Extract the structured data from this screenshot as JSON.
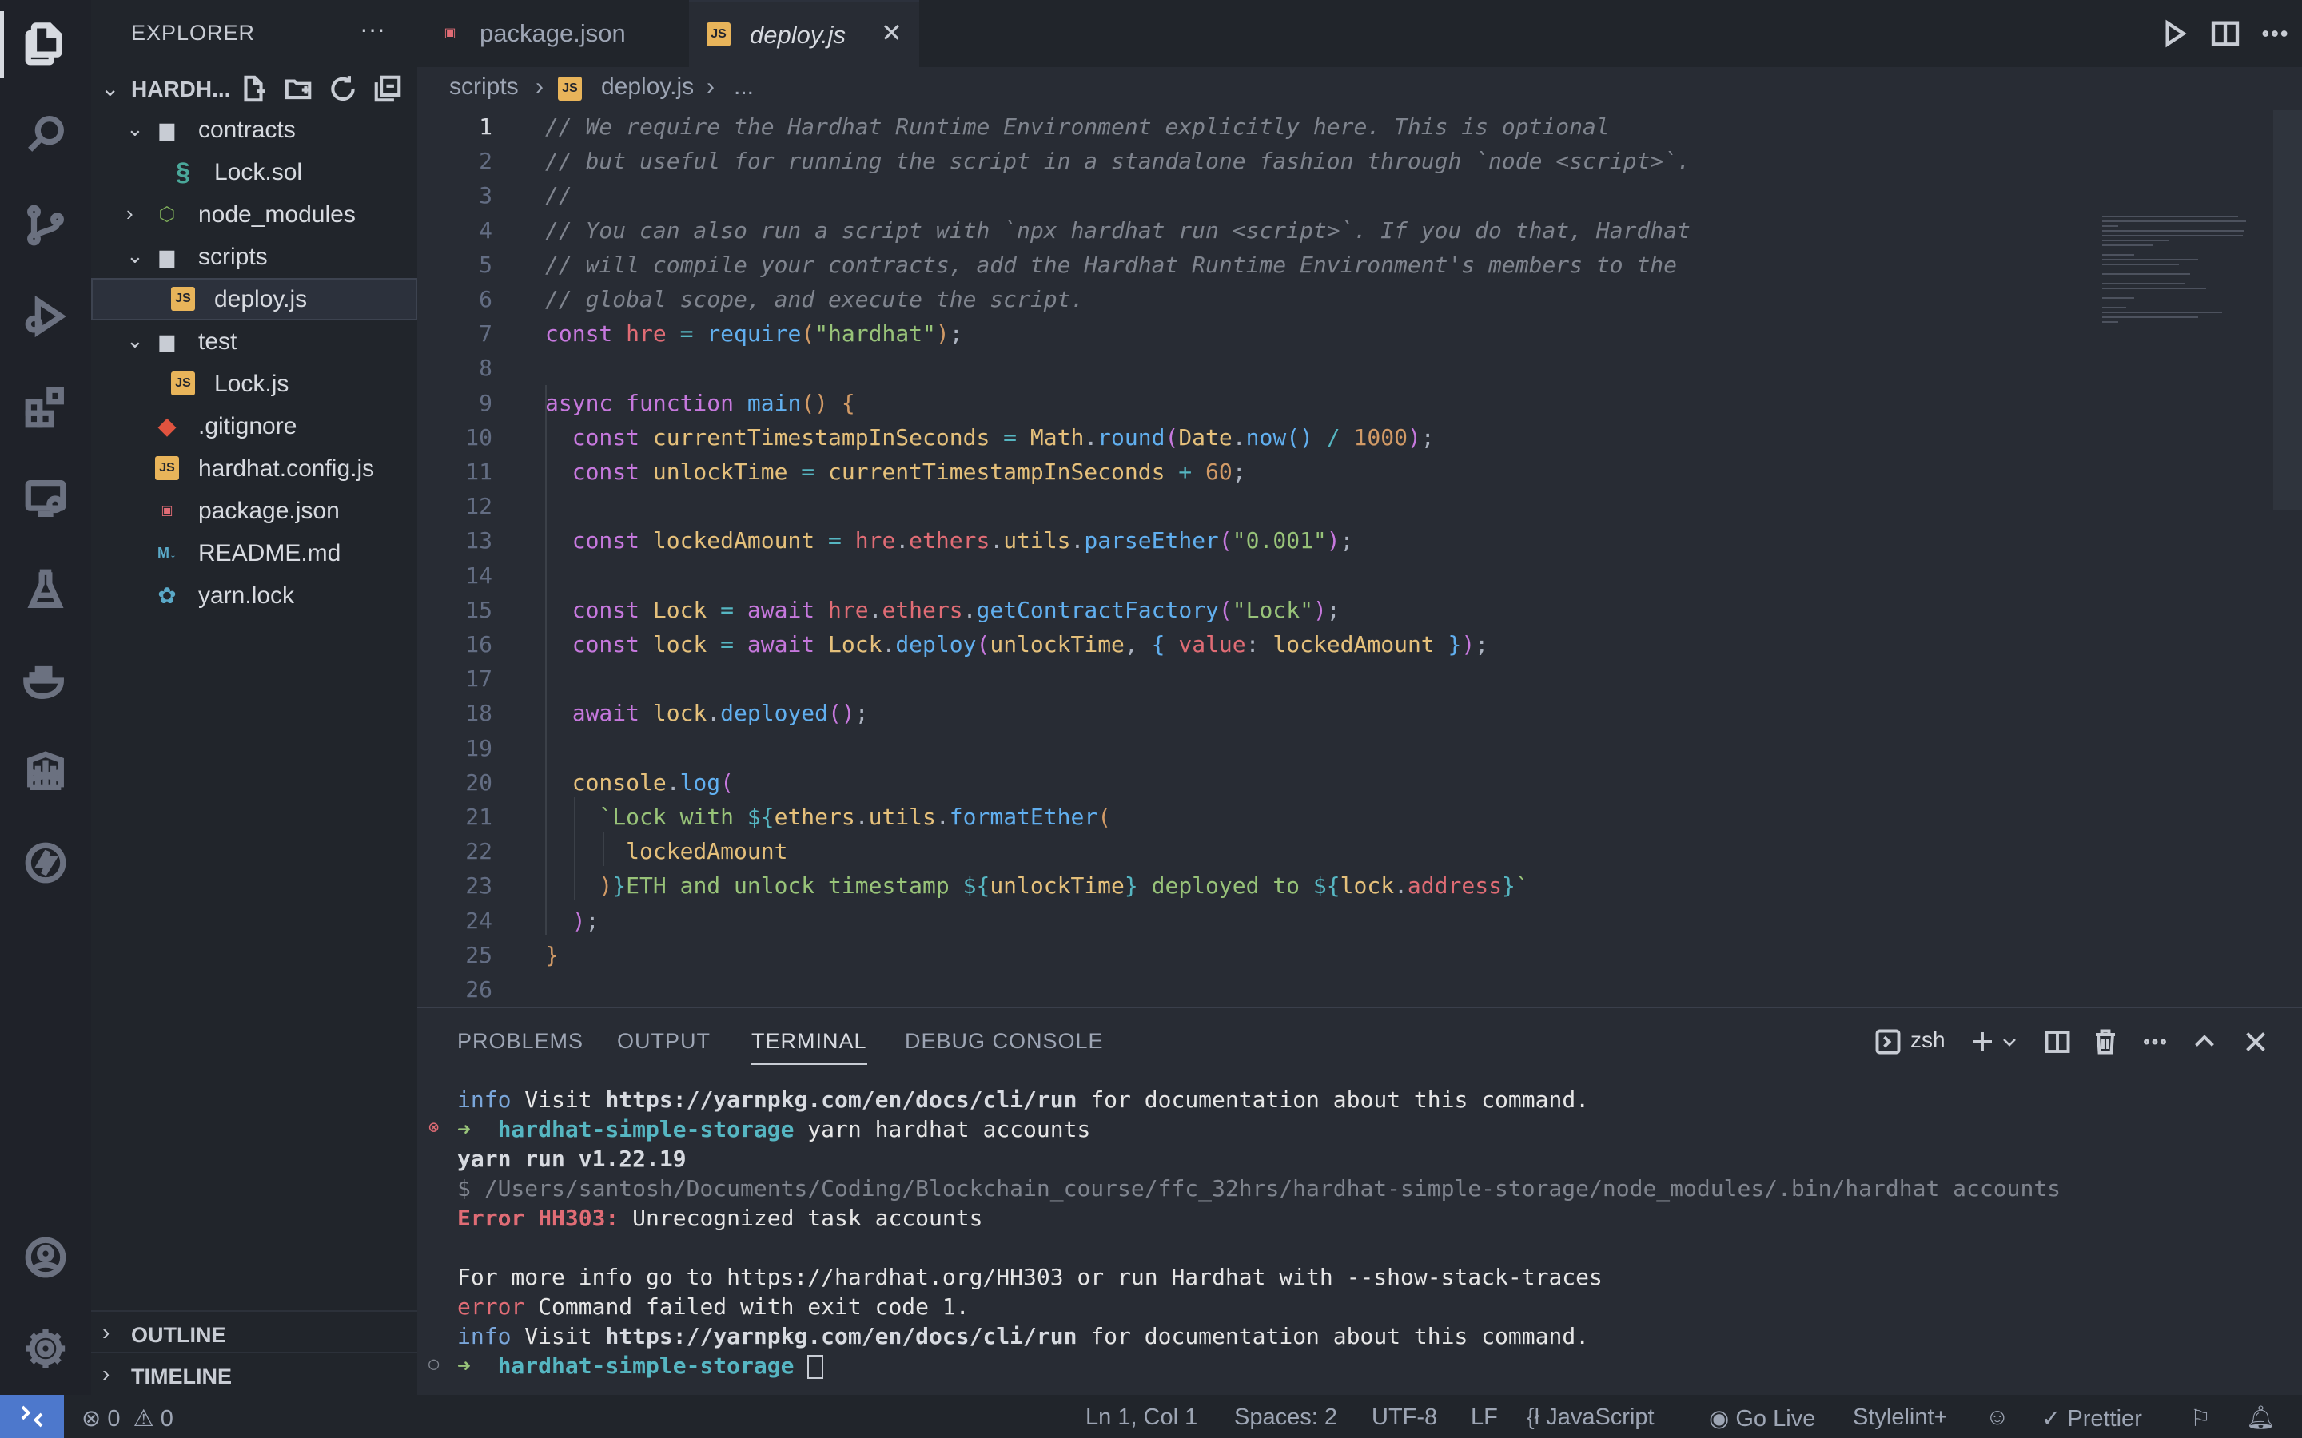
{
  "sidebar": {
    "title": "EXPLORER",
    "more": "···",
    "project": "HARDH...",
    "tree": [
      {
        "name": "contracts",
        "type": "folder",
        "open": true,
        "depth": 0
      },
      {
        "name": "Lock.sol",
        "type": "sol",
        "depth": 1
      },
      {
        "name": "node_modules",
        "type": "folder-node",
        "open": false,
        "depth": 0
      },
      {
        "name": "scripts",
        "type": "folder",
        "open": true,
        "depth": 0
      },
      {
        "name": "deploy.js",
        "type": "js",
        "depth": 1,
        "selected": true
      },
      {
        "name": "test",
        "type": "folder",
        "open": true,
        "depth": 0
      },
      {
        "name": "Lock.js",
        "type": "js",
        "depth": 1
      },
      {
        "name": ".gitignore",
        "type": "git",
        "depth": 0
      },
      {
        "name": "hardhat.config.js",
        "type": "js",
        "depth": 0
      },
      {
        "name": "package.json",
        "type": "json",
        "depth": 0
      },
      {
        "name": "README.md",
        "type": "md",
        "depth": 0
      },
      {
        "name": "yarn.lock",
        "type": "yarn",
        "depth": 0
      }
    ],
    "outline": "OUTLINE",
    "timeline": "TIMELINE"
  },
  "tabs": [
    {
      "name": "package.json",
      "icon": "json-icon",
      "active": false
    },
    {
      "name": "deploy.js",
      "icon": "js-icon",
      "active": true
    }
  ],
  "breadcrumb": {
    "folder": "scripts",
    "file": "deploy.js",
    "tail": "..."
  },
  "editor": {
    "lines": [
      [
        [
          "c-com",
          "// We require the Hardhat Runtime Environment explicitly here. This is optional"
        ]
      ],
      [
        [
          "c-com",
          "// but useful for running the script in a standalone fashion through `node <script>`."
        ]
      ],
      [
        [
          "c-com",
          "//"
        ]
      ],
      [
        [
          "c-com",
          "// You can also run a script with `npx hardhat run <script>`. If you do that, Hardhat"
        ]
      ],
      [
        [
          "c-com",
          "// will compile your contracts, add the Hardhat Runtime Environment's members to the"
        ]
      ],
      [
        [
          "c-com",
          "// global scope, and execute the script."
        ]
      ],
      [
        [
          "c-kw",
          "const "
        ],
        [
          "c-var",
          "hre"
        ],
        [
          "c-op",
          " = "
        ],
        [
          "c-fn",
          "require"
        ],
        [
          "c-br",
          "("
        ],
        [
          "c-str",
          "\"hardhat\""
        ],
        [
          "c-br",
          ")"
        ],
        [
          "c-pl",
          ";"
        ]
      ],
      [],
      [
        [
          "c-kw",
          "async function "
        ],
        [
          "c-fn",
          "main"
        ],
        [
          "c-br",
          "() {"
        ]
      ],
      [
        [
          "c-kw",
          "  const "
        ],
        [
          "c-cls",
          "currentTimestampInSeconds"
        ],
        [
          "c-op",
          " = "
        ],
        [
          "c-cls",
          "Math"
        ],
        [
          "c-pl",
          "."
        ],
        [
          "c-fn",
          "round"
        ],
        [
          "c-br2",
          "("
        ],
        [
          "c-cls",
          "Date"
        ],
        [
          "c-pl",
          "."
        ],
        [
          "c-fn",
          "now"
        ],
        [
          "c-br3",
          "()"
        ],
        [
          "c-op",
          " / "
        ],
        [
          "c-num",
          "1000"
        ],
        [
          "c-br2",
          ")"
        ],
        [
          "c-pl",
          ";"
        ]
      ],
      [
        [
          "c-kw",
          "  const "
        ],
        [
          "c-cls",
          "unlockTime"
        ],
        [
          "c-op",
          " = "
        ],
        [
          "c-cls",
          "currentTimestampInSeconds"
        ],
        [
          "c-op",
          " + "
        ],
        [
          "c-num",
          "60"
        ],
        [
          "c-pl",
          ";"
        ]
      ],
      [],
      [
        [
          "c-kw",
          "  const "
        ],
        [
          "c-cls",
          "lockedAmount"
        ],
        [
          "c-op",
          " = "
        ],
        [
          "c-var",
          "hre"
        ],
        [
          "c-pl",
          "."
        ],
        [
          "c-var",
          "ethers"
        ],
        [
          "c-pl",
          "."
        ],
        [
          "c-cls",
          "utils"
        ],
        [
          "c-pl",
          "."
        ],
        [
          "c-fn",
          "parseEther"
        ],
        [
          "c-br2",
          "("
        ],
        [
          "c-str",
          "\"0.001\""
        ],
        [
          "c-br2",
          ")"
        ],
        [
          "c-pl",
          ";"
        ]
      ],
      [],
      [
        [
          "c-kw",
          "  const "
        ],
        [
          "c-cls",
          "Lock"
        ],
        [
          "c-op",
          " = "
        ],
        [
          "c-kw",
          "await "
        ],
        [
          "c-var",
          "hre"
        ],
        [
          "c-pl",
          "."
        ],
        [
          "c-var",
          "ethers"
        ],
        [
          "c-pl",
          "."
        ],
        [
          "c-fn",
          "getContractFactory"
        ],
        [
          "c-br2",
          "("
        ],
        [
          "c-str",
          "\"Lock\""
        ],
        [
          "c-br2",
          ")"
        ],
        [
          "c-pl",
          ";"
        ]
      ],
      [
        [
          "c-kw",
          "  const "
        ],
        [
          "c-cls",
          "lock"
        ],
        [
          "c-op",
          " = "
        ],
        [
          "c-kw",
          "await "
        ],
        [
          "c-cls",
          "Lock"
        ],
        [
          "c-pl",
          "."
        ],
        [
          "c-fn",
          "deploy"
        ],
        [
          "c-br2",
          "("
        ],
        [
          "c-cls",
          "unlockTime"
        ],
        [
          "c-pl",
          ", "
        ],
        [
          "c-br3",
          "{ "
        ],
        [
          "c-var",
          "value"
        ],
        [
          "c-pl",
          ": "
        ],
        [
          "c-cls",
          "lockedAmount"
        ],
        [
          "c-br3",
          " }"
        ],
        [
          "c-br2",
          ")"
        ],
        [
          "c-pl",
          ";"
        ]
      ],
      [],
      [
        [
          "c-kw",
          "  await "
        ],
        [
          "c-cls",
          "lock"
        ],
        [
          "c-pl",
          "."
        ],
        [
          "c-fn",
          "deployed"
        ],
        [
          "c-br2",
          "()"
        ],
        [
          "c-pl",
          ";"
        ]
      ],
      [],
      [
        [
          "c-cls",
          "  console"
        ],
        [
          "c-pl",
          "."
        ],
        [
          "c-fn",
          "log"
        ],
        [
          "c-br2",
          "("
        ]
      ],
      [
        [
          "c-str",
          "    `Lock with "
        ],
        [
          "c-op",
          "${"
        ],
        [
          "c-cls",
          "ethers"
        ],
        [
          "c-pl",
          "."
        ],
        [
          "c-cls",
          "utils"
        ],
        [
          "c-pl",
          "."
        ],
        [
          "c-fn",
          "formatEther"
        ],
        [
          "c-br",
          "("
        ]
      ],
      [
        [
          "c-cls",
          "      lockedAmount"
        ]
      ],
      [
        [
          "c-br",
          "    )"
        ],
        [
          "c-op",
          "}"
        ],
        [
          "c-str",
          "ETH and unlock timestamp "
        ],
        [
          "c-op",
          "${"
        ],
        [
          "c-cls",
          "unlockTime"
        ],
        [
          "c-op",
          "}"
        ],
        [
          "c-str",
          " deployed to "
        ],
        [
          "c-op",
          "${"
        ],
        [
          "c-cls",
          "lock"
        ],
        [
          "c-pl",
          "."
        ],
        [
          "c-var",
          "address"
        ],
        [
          "c-op",
          "}"
        ],
        [
          "c-str",
          "`"
        ]
      ],
      [
        [
          "c-br2",
          "  )"
        ],
        [
          "c-pl",
          ";"
        ]
      ],
      [
        [
          "c-br",
          "}"
        ]
      ],
      []
    ]
  },
  "panel": {
    "tabs": [
      "PROBLEMS",
      "OUTPUT",
      "TERMINAL",
      "DEBUG CONSOLE"
    ],
    "active_tab": "TERMINAL",
    "shell": "zsh",
    "terminal": [
      {
        "parts": [
          [
            "t-info",
            "info"
          ],
          [
            "t-white",
            " Visit "
          ],
          [
            "t-bold",
            "https://yarnpkg.com/en/docs/cli/run"
          ],
          [
            "t-white",
            " for documentation about this command."
          ]
        ]
      },
      {
        "parts": [
          [
            "t-green",
            "➜  "
          ],
          [
            "t-cyan",
            "hardhat-simple-storage"
          ],
          [
            "t-white",
            " yarn hardhat accounts"
          ]
        ],
        "marker": "error"
      },
      {
        "parts": [
          [
            "t-bold",
            "yarn run v1.22.19"
          ]
        ]
      },
      {
        "parts": [
          [
            "t-dim",
            "$ /Users/santosh/Documents/Coding/Blockchain_course/ffc_32hrs/hardhat-simple-storage/node_modules/.bin/hardhat accounts"
          ]
        ]
      },
      {
        "parts": [
          [
            "t-err",
            "Error HH303:"
          ],
          [
            "t-white",
            " Unrecognized task accounts"
          ]
        ]
      },
      {
        "parts": []
      },
      {
        "parts": [
          [
            "t-white",
            "For more info go to https://hardhat.org/HH303 or run Hardhat with --show-stack-traces"
          ]
        ]
      },
      {
        "parts": [
          [
            "t-errl",
            "error"
          ],
          [
            "t-white",
            " Command failed with exit code 1."
          ]
        ]
      },
      {
        "parts": [
          [
            "t-info",
            "info"
          ],
          [
            "t-white",
            " Visit "
          ],
          [
            "t-bold",
            "https://yarnpkg.com/en/docs/cli/run"
          ],
          [
            "t-white",
            " for documentation about this command."
          ]
        ]
      },
      {
        "parts": [
          [
            "t-green",
            "➜  "
          ],
          [
            "t-cyan",
            "hardhat-simple-storage"
          ],
          [
            "t-white",
            " "
          ]
        ],
        "marker": "idle",
        "cursor": true
      }
    ]
  },
  "status": {
    "errors": "0",
    "warnings": "0",
    "position": "Ln 1, Col 1",
    "spaces": "Spaces: 2",
    "encoding": "UTF-8",
    "eol": "LF",
    "language": "JavaScript",
    "golive": "Go Live",
    "stylelint": "Stylelint+",
    "prettier": "Prettier"
  }
}
